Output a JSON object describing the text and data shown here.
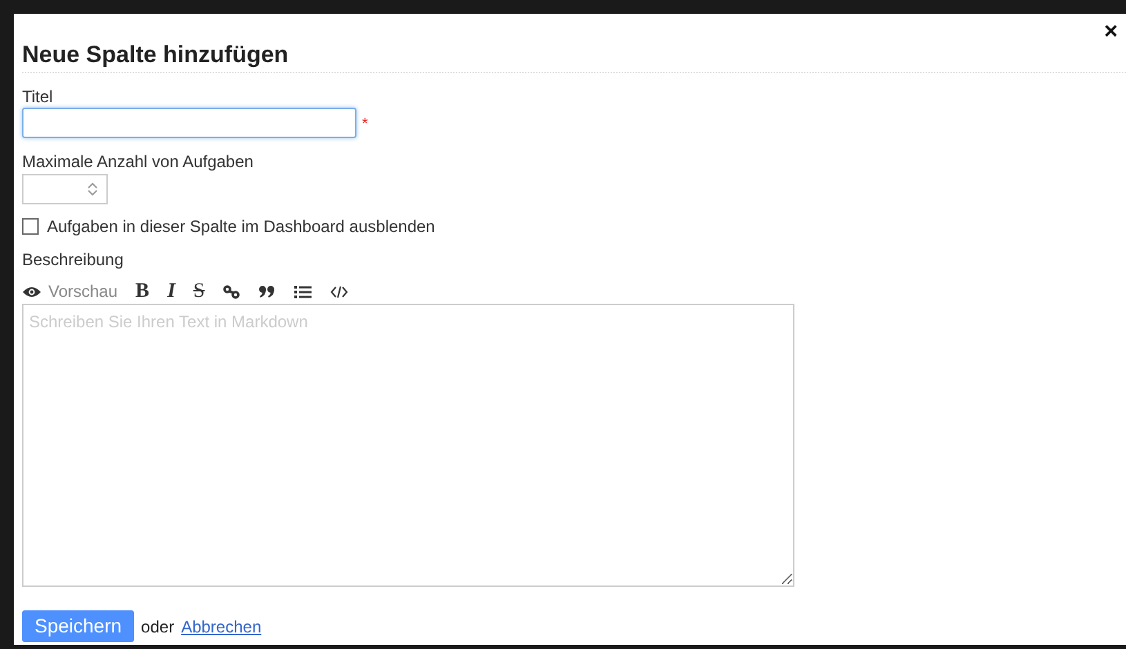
{
  "dialog": {
    "title": "Neue Spalte hinzufügen",
    "close": "×"
  },
  "title_field": {
    "label": "Titel",
    "required_mark": "*"
  },
  "max_tasks_field": {
    "label": "Maximale Anzahl von Aufgaben"
  },
  "hide_checkbox": {
    "label": "Aufgaben in dieser Spalte im Dashboard ausblenden",
    "checked": false
  },
  "description": {
    "label": "Beschreibung",
    "placeholder": "Schreiben Sie Ihren Text in Markdown",
    "toolbar": [
      {
        "kind": "preview",
        "label": "Vorschau"
      },
      {
        "kind": "bold",
        "text": "B"
      },
      {
        "kind": "italic",
        "text": "I"
      },
      {
        "kind": "strike",
        "text": "S"
      },
      {
        "kind": "link"
      },
      {
        "kind": "quote"
      },
      {
        "kind": "list"
      },
      {
        "kind": "code"
      }
    ]
  },
  "actions": {
    "save": "Speichern",
    "separator": "oder",
    "cancel": "Abbrechen"
  }
}
